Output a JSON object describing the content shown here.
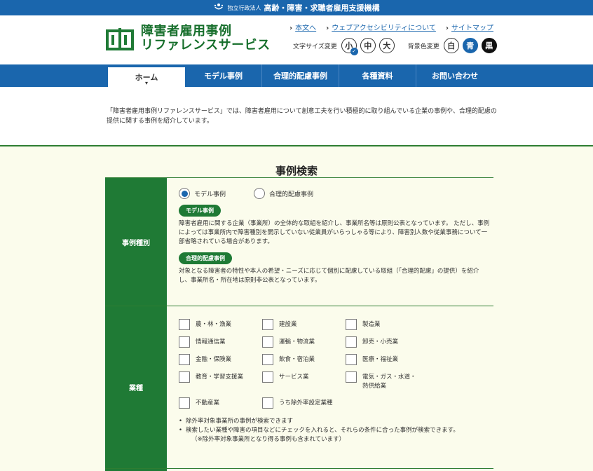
{
  "topbar": {
    "org_prefix": "独立行政法人",
    "org_name": "高齢・障害・求職者雇用支援機構"
  },
  "logo": {
    "line1": "障害者雇用事例",
    "line2": "リファレンスサービス"
  },
  "util_links": {
    "main_content": "本文へ",
    "accessibility": "ウェブアクセシビリティについて",
    "sitemap": "サイトマップ"
  },
  "font_size": {
    "label": "文字サイズ変更",
    "small": "小",
    "medium": "中",
    "large": "大"
  },
  "bg_color": {
    "label": "背景色変更",
    "white": "白",
    "blue": "青",
    "black": "黒"
  },
  "nav": {
    "home": "ホーム",
    "model": "モデル事例",
    "reasonable": "合理的配慮事例",
    "materials": "各種資料",
    "contact": "お問い合わせ"
  },
  "intro": "「障害者雇用事例リファレンスサービス」では、障害者雇用について創意工夫を行い積極的に取り組んでいる企業の事例や、合理的配慮の提供に関する事例を紹介しています。",
  "search": {
    "title": "事例検索",
    "kind": {
      "head": "事例種別",
      "opt_model": "モデル事例",
      "opt_reasonable": "合理的配慮事例",
      "pill_model": "モデル事例",
      "desc_model": "障害者雇用に関する企業（事業所）の全体的な取組を紹介し、事業所名等は原則公表となっています。 ただし、事例によっては事業所内で障害種別を開示していない従業員がいらっしゃる等により、障害別人数や従業事務について一部省略されている場合があります。",
      "pill_reasonable": "合理的配慮事例",
      "desc_reasonable": "対象となる障害者の特性や本人の希望・ニーズに応じて個別に配慮している取組（「合理的配慮」の提供）を紹介し、事業所名・所在地は原則非公表となっています。"
    },
    "industry": {
      "head": "業種",
      "items": [
        "農・林・漁業",
        "建設業",
        "製造業",
        "情報通信業",
        "運輸・物流業",
        "卸売・小売業",
        "金融・保険業",
        "飲食・宿泊業",
        "医療・福祉業",
        "教育・学習支援業",
        "サービス業",
        "電気・ガス・水道・",
        "熱供給業",
        "不動産業",
        "うち除外率設定業種"
      ],
      "note1": "除外率対象事業所の事例が検索できます",
      "note2": "検索したい業種や障害の項目などにチェックを入れると、それらの条件に合った事例が検索できます。",
      "note3": "（※除外率対象事業所となり得る事例も含まれています）"
    }
  }
}
